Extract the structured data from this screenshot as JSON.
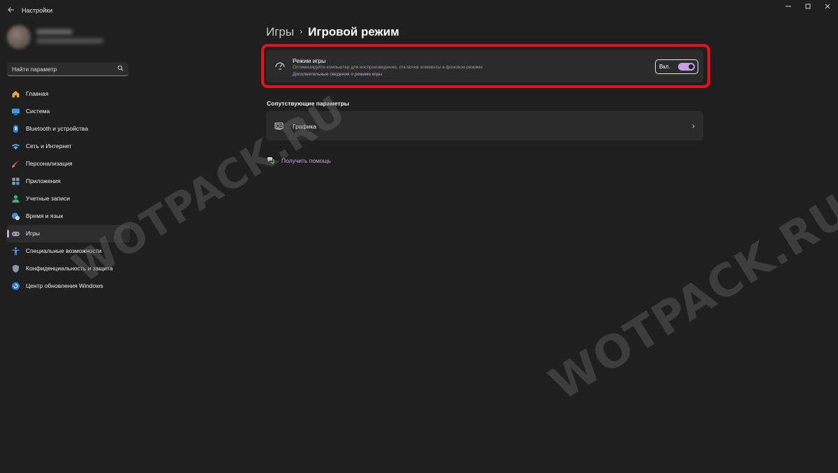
{
  "window": {
    "title": "Настройки",
    "back_icon": "back-arrow-icon",
    "controls": [
      "minimize-icon",
      "maximize-icon",
      "close-icon"
    ]
  },
  "sidebar": {
    "search": {
      "placeholder": "Найти параметр",
      "icon": "search-icon"
    },
    "items": [
      {
        "label": "Главная",
        "icon": "home-icon",
        "color": "#e8a33a"
      },
      {
        "label": "Система",
        "icon": "monitor-icon",
        "color": "#3b9be8"
      },
      {
        "label": "Bluetooth и устройства",
        "icon": "bluetooth-icon",
        "color": "#2f7fe0"
      },
      {
        "label": "Сеть и Интернет",
        "icon": "wifi-icon",
        "color": "#5aa8e8"
      },
      {
        "label": "Персонализация",
        "icon": "brush-icon",
        "color": "#e89a4a"
      },
      {
        "label": "Приложения",
        "icon": "apps-icon",
        "color": "#8aa0b8"
      },
      {
        "label": "Учетные записи",
        "icon": "person-icon",
        "color": "#3fb07a"
      },
      {
        "label": "Время и язык",
        "icon": "globe-clock-icon",
        "color": "#3b8fe0"
      },
      {
        "label": "Игры",
        "icon": "gamepad-icon",
        "color": "#9aa0a8",
        "active": true
      },
      {
        "label": "Специальные возможности",
        "icon": "accessibility-icon",
        "color": "#3b9be8"
      },
      {
        "label": "Конфиденциальность и защита",
        "icon": "shield-icon",
        "color": "#8a95a5"
      },
      {
        "label": "Центр обновления Windows",
        "icon": "update-icon",
        "color": "#2f7fe0"
      }
    ]
  },
  "breadcrumb": {
    "parent": "Игры",
    "current": "Игровой режим"
  },
  "game_mode": {
    "title": "Режим игры",
    "description": "Оптимизируйте компьютер для воспроизведения, отключив элементы в фоновом режиме",
    "link": "Дополнительные сведения о режиме игры",
    "toggle_label": "Вкл.",
    "toggle_on": true,
    "icon": "game-mode-gauge-icon"
  },
  "related": {
    "title": "Сопутствующие параметры",
    "items": [
      {
        "label": "Графика",
        "icon": "display-adapter-icon"
      }
    ]
  },
  "help": {
    "label": "Получить помощь",
    "icon": "help-icon"
  },
  "watermark": {
    "text": "WOTPACK.RU"
  },
  "colors": {
    "accent": "#c69fe6",
    "highlight_border": "#e8101c"
  }
}
